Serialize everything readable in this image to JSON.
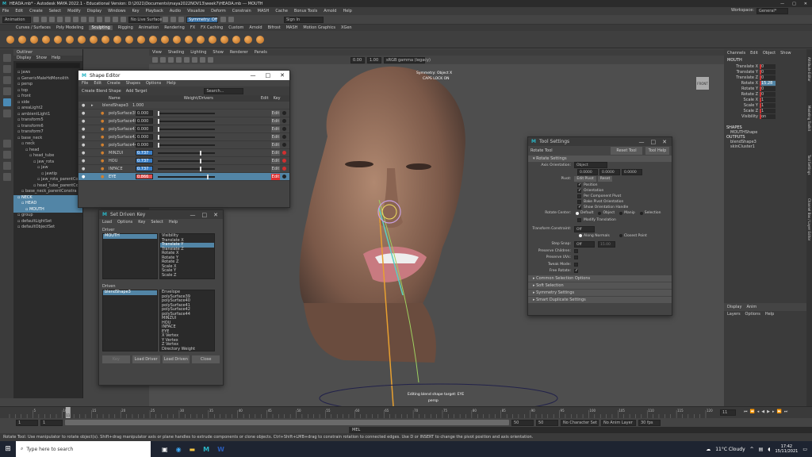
{
  "window": {
    "title": "HEADA.mb* - Autodesk MAYA 2022.1 - Educational Version: D:\\2021\\Documents\\maya2022NOV13\\week7\\HEADA.mb  ---  MOUTH"
  },
  "menubar": [
    "File",
    "Edit",
    "Create",
    "Select",
    "Modify",
    "Display",
    "Windows",
    "Key",
    "Playback",
    "Audio",
    "Visualize",
    "Deform",
    "Constrain",
    "MASH",
    "Cache",
    "Bonus Tools",
    "Arnold",
    "Help"
  ],
  "workspace": {
    "label": "Workspace:",
    "value": "General*"
  },
  "status": {
    "mode": "Animation",
    "live_surface": "No Live Surface",
    "symmetry": "Symmetry: Off",
    "sign_in": "Sign In"
  },
  "shelf_tabs": [
    "Curves / Surfaces",
    "Poly Modeling",
    "Sculpting",
    "Rigging",
    "Animation",
    "Rendering",
    "FX",
    "FX Caching",
    "Custom",
    "Arnold",
    "Bifrost",
    "MASH",
    "Motion Graphics",
    "XGen"
  ],
  "shelf_active": "Sculpting",
  "outliner": {
    "title": "Outliner",
    "menu": [
      "Display",
      "Show",
      "Help"
    ],
    "items": [
      {
        "label": "jaws",
        "indent": 1,
        "sel": false
      },
      {
        "label": "GenericMaleHdMonolith",
        "indent": 1,
        "sel": false
      },
      {
        "label": "persp",
        "indent": 1,
        "sel": false
      },
      {
        "label": "top",
        "indent": 1,
        "sel": false
      },
      {
        "label": "front",
        "indent": 1,
        "sel": false
      },
      {
        "label": "side",
        "indent": 1,
        "sel": false
      },
      {
        "label": "areaLight2",
        "indent": 1,
        "sel": false
      },
      {
        "label": "ambientLight1",
        "indent": 1,
        "sel": false
      },
      {
        "label": "transform5",
        "indent": 1,
        "sel": false
      },
      {
        "label": "transform6",
        "indent": 1,
        "sel": false
      },
      {
        "label": "transform7",
        "indent": 1,
        "sel": false
      },
      {
        "label": "base_neck",
        "indent": 1,
        "sel": false
      },
      {
        "label": "neck",
        "indent": 2,
        "sel": false
      },
      {
        "label": "head",
        "indent": 3,
        "sel": false
      },
      {
        "label": "head_tube",
        "indent": 4,
        "sel": false
      },
      {
        "label": "jaw_rota",
        "indent": 5,
        "sel": false
      },
      {
        "label": "jaw",
        "indent": 6,
        "sel": false
      },
      {
        "label": "jawtip",
        "indent": 7,
        "sel": false
      },
      {
        "label": "jaw_rota_parentConstr",
        "indent": 6,
        "sel": false
      },
      {
        "label": "head_tube_parentCon",
        "indent": 5,
        "sel": false
      },
      {
        "label": "base_neck_parentConstra",
        "indent": 2,
        "sel": false
      },
      {
        "label": "NECK",
        "indent": 1,
        "sel": true
      },
      {
        "label": "HEAD",
        "indent": 2,
        "sel": true
      },
      {
        "label": "MOUTH",
        "indent": 3,
        "sel": true
      },
      {
        "label": "group",
        "indent": 1,
        "sel": false
      },
      {
        "label": "defaultLightSet",
        "indent": 1,
        "sel": false
      },
      {
        "label": "defaultObjectSet",
        "indent": 1,
        "sel": false
      }
    ]
  },
  "viewport": {
    "menu": [
      "View",
      "Shading",
      "Lighting",
      "Show",
      "Renderer",
      "Panels"
    ],
    "gamma": "sRGB gamma (legacy)",
    "exposure": "0.00",
    "gamma_value": "1.00",
    "hud_symmetry": "Symmetry: Object X",
    "hud_caps": "CAPS LOCK ON",
    "hud_editing": "Editing blend shape target: EYE",
    "camera": "persp",
    "cube_label": "FRONT"
  },
  "channel_box": {
    "tabs": [
      "Channels",
      "Edit",
      "Object",
      "Show"
    ],
    "object": "MOUTH",
    "channels": [
      {
        "name": "Translate X",
        "value": "0"
      },
      {
        "name": "Translate Y",
        "value": "0"
      },
      {
        "name": "Translate Z",
        "value": "0"
      },
      {
        "name": "Rotate X",
        "value": "15.28"
      },
      {
        "name": "Rotate Y",
        "value": "0"
      },
      {
        "name": "Rotate Z",
        "value": "0"
      },
      {
        "name": "Scale X",
        "value": "1"
      },
      {
        "name": "Scale Y",
        "value": "1"
      },
      {
        "name": "Scale Z",
        "value": "1"
      },
      {
        "name": "Visibility",
        "value": "on"
      }
    ],
    "shapes_label": "SHAPES",
    "shape": "MOUTHShape",
    "outputs_label": "OUTPUTS",
    "outputs": [
      "blendShape3",
      "skinCluster1"
    ],
    "side_tabs": [
      "Attribute Editor",
      "Modeling Toolkit",
      "Tool Settings",
      "Channel Box / Layer Editor"
    ],
    "layer_tabs": [
      "Display",
      "Anim"
    ],
    "layer_menu": [
      "Layers",
      "Options",
      "Help"
    ]
  },
  "shape_editor": {
    "title": "Shape Editor",
    "menu": [
      "File",
      "Edit",
      "Create",
      "Shapes",
      "Options",
      "Help"
    ],
    "create_label": "Create Blend Shape",
    "add_label": "Add Target",
    "search_placeholder": "Search...",
    "headers": {
      "name": "Name",
      "weight": "Weight/Drivers",
      "edit": "Edit",
      "key": "Key"
    },
    "root": {
      "name": "blendShape3",
      "weight": "1.000"
    },
    "targets": [
      {
        "name": "polySurface39",
        "weight": "0.000",
        "level": 0.0,
        "edit": "Edit",
        "active": false,
        "driven": false
      },
      {
        "name": "polySurface40",
        "weight": "0.000",
        "level": 0.0,
        "edit": "Edit",
        "active": false,
        "driven": false
      },
      {
        "name": "polySurface41",
        "weight": "0.000",
        "level": 0.0,
        "edit": "Edit",
        "active": false,
        "driven": false
      },
      {
        "name": "polySurface42",
        "weight": "0.000",
        "level": 0.0,
        "edit": "Edit",
        "active": false,
        "driven": false
      },
      {
        "name": "polySurface44",
        "weight": "0.000",
        "level": 0.0,
        "edit": "Edit",
        "active": false,
        "driven": false
      },
      {
        "name": "MINZUI",
        "weight": "0.737",
        "level": 0.737,
        "edit": "Edit",
        "active": false,
        "driven": true
      },
      {
        "name": "HOU",
        "weight": "0.737",
        "level": 0.737,
        "edit": "Edit",
        "active": false,
        "driven": true
      },
      {
        "name": "INFACE",
        "weight": "0.737",
        "level": 0.737,
        "edit": "Edit",
        "active": false,
        "driven": true
      },
      {
        "name": "EYE",
        "weight": "0.866",
        "level": 0.866,
        "edit": "Edit",
        "active": true,
        "driven": true
      }
    ]
  },
  "sdk": {
    "title": "Set Driven Key",
    "menu": [
      "Load",
      "Options",
      "Key",
      "Select",
      "Help"
    ],
    "driver_label": "Driver",
    "driver_object": "MOUTH",
    "driver_attrs": [
      "Visibility",
      "Translate X",
      "Translate Y",
      "Translate Z",
      "Rotate X",
      "Rotate Y",
      "Rotate Z",
      "Scale X",
      "Scale Y",
      "Scale Z"
    ],
    "driver_attr_sel": "Translate Y",
    "driven_label": "Driven",
    "driven_object": "blendShape3",
    "driven_attrs": [
      "Envelope",
      "polySurface39",
      "polySurface40",
      "polySurface41",
      "polySurface42",
      "polySurface44",
      "MINZUI",
      "HOU",
      "INFACE",
      "EYE",
      "X Vertex",
      "Y Vertex",
      "Z Vertex",
      "Directory Weight"
    ],
    "buttons": [
      "Key",
      "Load Driver",
      "Load Driven",
      "Close"
    ]
  },
  "tool_settings": {
    "title": "Tool Settings",
    "tool": "Rotate Tool",
    "reset": "Reset Tool",
    "help": "Tool Help",
    "section1": "Rotate Settings",
    "axis_orientation_label": "Axis Orientation:",
    "axis_orientation": "Object",
    "axis_values": [
      "0.0000",
      "0.0000",
      "0.0000"
    ],
    "pivot_label": "Pivot:",
    "edit_pivot": "Edit Pivot",
    "reset_btn": "Reset",
    "pivot_checks": [
      {
        "label": "Position",
        "on": true
      },
      {
        "label": "Orientation",
        "on": true
      },
      {
        "label": "Per Component Pivot",
        "on": false
      },
      {
        "label": "Bake Pivot Orientation",
        "on": false
      },
      {
        "label": "Show Orientation Handle",
        "on": true
      }
    ],
    "rotate_center_label": "Rotate Center:",
    "rotate_center_opts": [
      "Default",
      "Object",
      "Manip",
      "Selection"
    ],
    "modify_translation": "Modify Translation",
    "transform_constraint_label": "Transform Constraint:",
    "transform_constraint": "Off",
    "along_normals": "Along Normals",
    "closest_point": "Closest Point",
    "step_snap_label": "Step Snap:",
    "step_snap": "Off",
    "step_snap_value": "15.00",
    "preserve_children": "Preserve Children:",
    "preserve_uvs": "Preserve UVs:",
    "tweak_mode": "Tweak Mode:",
    "free_rotate": "Free Rotate:",
    "sections": [
      "Common Selection Options",
      "Soft Selection",
      "Symmetry Settings",
      "Smart Duplicate Settings"
    ]
  },
  "timeline": {
    "ticks": [
      "5",
      "10",
      "15",
      "20",
      "25",
      "30",
      "35",
      "40",
      "45",
      "50",
      "55",
      "60",
      "65",
      "70",
      "75",
      "80",
      "85",
      "90",
      "95",
      "100",
      "105",
      "110",
      "115",
      "120"
    ],
    "current": "11",
    "current_field": "11",
    "start": "1",
    "range_start": "1",
    "range_end": "50",
    "end": "50",
    "end2": "50",
    "char_set": "No Character Set",
    "anim_layer": "No Anim Layer",
    "fps": "30 fps"
  },
  "helpline": "Rotate Tool: Use manipulator to rotate object(s). Shift+drag manipulator axis or plane handles to extrude components or clone objects. Ctrl+Shift+LMB+drag to constrain rotation to connected edges. Use D or INSERT to change the pivot position and axis orientation.",
  "mel": "MEL",
  "taskbar": {
    "search": "Type here to search",
    "weather": "11°C Cloudy",
    "time": "17:42",
    "date": "15/11/2021"
  }
}
